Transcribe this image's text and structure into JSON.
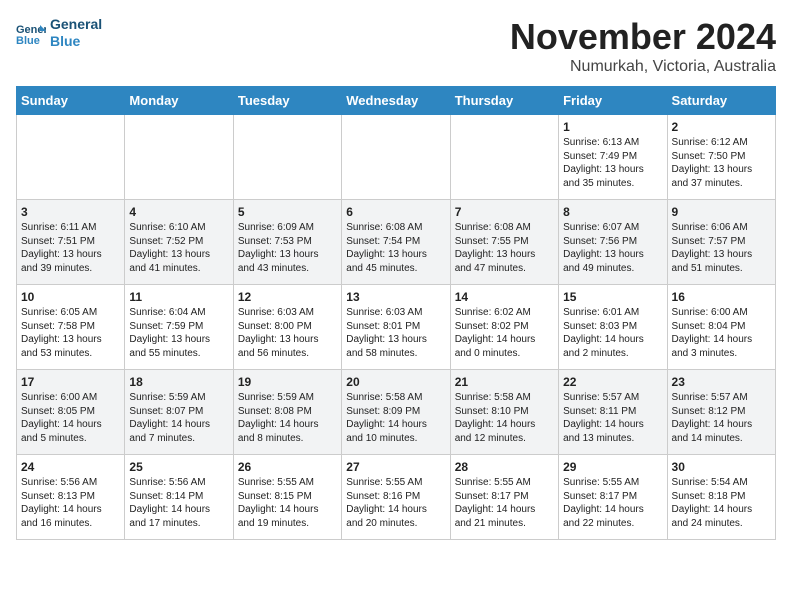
{
  "logo": {
    "line1": "General",
    "line2": "Blue"
  },
  "title": "November 2024",
  "subtitle": "Numurkah, Victoria, Australia",
  "weekdays": [
    "Sunday",
    "Monday",
    "Tuesday",
    "Wednesday",
    "Thursday",
    "Friday",
    "Saturday"
  ],
  "weeks": [
    [
      {
        "day": "",
        "content": ""
      },
      {
        "day": "",
        "content": ""
      },
      {
        "day": "",
        "content": ""
      },
      {
        "day": "",
        "content": ""
      },
      {
        "day": "",
        "content": ""
      },
      {
        "day": "1",
        "content": "Sunrise: 6:13 AM\nSunset: 7:49 PM\nDaylight: 13 hours\nand 35 minutes."
      },
      {
        "day": "2",
        "content": "Sunrise: 6:12 AM\nSunset: 7:50 PM\nDaylight: 13 hours\nand 37 minutes."
      }
    ],
    [
      {
        "day": "3",
        "content": "Sunrise: 6:11 AM\nSunset: 7:51 PM\nDaylight: 13 hours\nand 39 minutes."
      },
      {
        "day": "4",
        "content": "Sunrise: 6:10 AM\nSunset: 7:52 PM\nDaylight: 13 hours\nand 41 minutes."
      },
      {
        "day": "5",
        "content": "Sunrise: 6:09 AM\nSunset: 7:53 PM\nDaylight: 13 hours\nand 43 minutes."
      },
      {
        "day": "6",
        "content": "Sunrise: 6:08 AM\nSunset: 7:54 PM\nDaylight: 13 hours\nand 45 minutes."
      },
      {
        "day": "7",
        "content": "Sunrise: 6:08 AM\nSunset: 7:55 PM\nDaylight: 13 hours\nand 47 minutes."
      },
      {
        "day": "8",
        "content": "Sunrise: 6:07 AM\nSunset: 7:56 PM\nDaylight: 13 hours\nand 49 minutes."
      },
      {
        "day": "9",
        "content": "Sunrise: 6:06 AM\nSunset: 7:57 PM\nDaylight: 13 hours\nand 51 minutes."
      }
    ],
    [
      {
        "day": "10",
        "content": "Sunrise: 6:05 AM\nSunset: 7:58 PM\nDaylight: 13 hours\nand 53 minutes."
      },
      {
        "day": "11",
        "content": "Sunrise: 6:04 AM\nSunset: 7:59 PM\nDaylight: 13 hours\nand 55 minutes."
      },
      {
        "day": "12",
        "content": "Sunrise: 6:03 AM\nSunset: 8:00 PM\nDaylight: 13 hours\nand 56 minutes."
      },
      {
        "day": "13",
        "content": "Sunrise: 6:03 AM\nSunset: 8:01 PM\nDaylight: 13 hours\nand 58 minutes."
      },
      {
        "day": "14",
        "content": "Sunrise: 6:02 AM\nSunset: 8:02 PM\nDaylight: 14 hours\nand 0 minutes."
      },
      {
        "day": "15",
        "content": "Sunrise: 6:01 AM\nSunset: 8:03 PM\nDaylight: 14 hours\nand 2 minutes."
      },
      {
        "day": "16",
        "content": "Sunrise: 6:00 AM\nSunset: 8:04 PM\nDaylight: 14 hours\nand 3 minutes."
      }
    ],
    [
      {
        "day": "17",
        "content": "Sunrise: 6:00 AM\nSunset: 8:05 PM\nDaylight: 14 hours\nand 5 minutes."
      },
      {
        "day": "18",
        "content": "Sunrise: 5:59 AM\nSunset: 8:07 PM\nDaylight: 14 hours\nand 7 minutes."
      },
      {
        "day": "19",
        "content": "Sunrise: 5:59 AM\nSunset: 8:08 PM\nDaylight: 14 hours\nand 8 minutes."
      },
      {
        "day": "20",
        "content": "Sunrise: 5:58 AM\nSunset: 8:09 PM\nDaylight: 14 hours\nand 10 minutes."
      },
      {
        "day": "21",
        "content": "Sunrise: 5:58 AM\nSunset: 8:10 PM\nDaylight: 14 hours\nand 12 minutes."
      },
      {
        "day": "22",
        "content": "Sunrise: 5:57 AM\nSunset: 8:11 PM\nDaylight: 14 hours\nand 13 minutes."
      },
      {
        "day": "23",
        "content": "Sunrise: 5:57 AM\nSunset: 8:12 PM\nDaylight: 14 hours\nand 14 minutes."
      }
    ],
    [
      {
        "day": "24",
        "content": "Sunrise: 5:56 AM\nSunset: 8:13 PM\nDaylight: 14 hours\nand 16 minutes."
      },
      {
        "day": "25",
        "content": "Sunrise: 5:56 AM\nSunset: 8:14 PM\nDaylight: 14 hours\nand 17 minutes."
      },
      {
        "day": "26",
        "content": "Sunrise: 5:55 AM\nSunset: 8:15 PM\nDaylight: 14 hours\nand 19 minutes."
      },
      {
        "day": "27",
        "content": "Sunrise: 5:55 AM\nSunset: 8:16 PM\nDaylight: 14 hours\nand 20 minutes."
      },
      {
        "day": "28",
        "content": "Sunrise: 5:55 AM\nSunset: 8:17 PM\nDaylight: 14 hours\nand 21 minutes."
      },
      {
        "day": "29",
        "content": "Sunrise: 5:55 AM\nSunset: 8:17 PM\nDaylight: 14 hours\nand 22 minutes."
      },
      {
        "day": "30",
        "content": "Sunrise: 5:54 AM\nSunset: 8:18 PM\nDaylight: 14 hours\nand 24 minutes."
      }
    ]
  ]
}
